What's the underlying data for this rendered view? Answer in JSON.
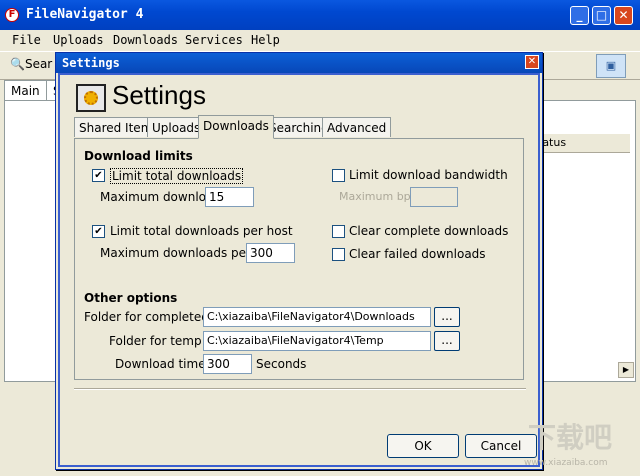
{
  "app": {
    "title": "FileNavigator 4",
    "logo": "F"
  },
  "window_controls": {
    "minimize": "_",
    "maximize": "□",
    "close": "✕"
  },
  "menu": [
    "File",
    "Uploads",
    "Downloads",
    "Services",
    "Help"
  ],
  "toolbar": {
    "search_label": "Sear"
  },
  "main_tabs": [
    "Main",
    "S"
  ],
  "main_table": {
    "status_header": "tatus"
  },
  "dialog": {
    "title": "Settings",
    "close": "✕",
    "header_title": "Settings",
    "tabs": [
      "Shared Items",
      "Uploads",
      "Downloads",
      "Searching",
      "Advanced"
    ],
    "active_tab": "Downloads",
    "download_limits": {
      "title": "Download limits",
      "limit_total": {
        "label": "Limit total downloads",
        "checked": true
      },
      "max_downloads_label": "Maximum downloads:",
      "max_downloads_value": "15",
      "limit_bandwidth": {
        "label": "Limit download bandwidth",
        "checked": false
      },
      "max_bps_label": "Maximum bps:",
      "max_bps_value": "",
      "limit_per_host": {
        "label": "Limit total downloads per host",
        "checked": true
      },
      "max_per_host_label": "Maximum downloads per host:",
      "max_per_host_value": "300",
      "clear_complete": {
        "label": "Clear complete downloads",
        "checked": false
      },
      "clear_failed": {
        "label": "Clear failed downloads",
        "checked": false
      }
    },
    "other_options": {
      "title": "Other options",
      "completed_label": "Folder for completed files:",
      "completed_value": "C:\\xiazaiba\\FileNavigator4\\Downloads",
      "temp_label": "Folder for temp files:",
      "temp_value": "C:\\xiazaiba\\FileNavigator4\\Temp",
      "browse": "...",
      "timeout_label": "Download timeout:",
      "timeout_value": "300",
      "timeout_unit": "Seconds"
    },
    "ok": "OK",
    "cancel": "Cancel"
  },
  "watermark": {
    "text": "下载吧",
    "url": "www.xiazaiba.com"
  },
  "colors": {
    "titlebar": "#0048d0",
    "dialog_border": "#3b5fcf",
    "face": "#ece9d8"
  }
}
